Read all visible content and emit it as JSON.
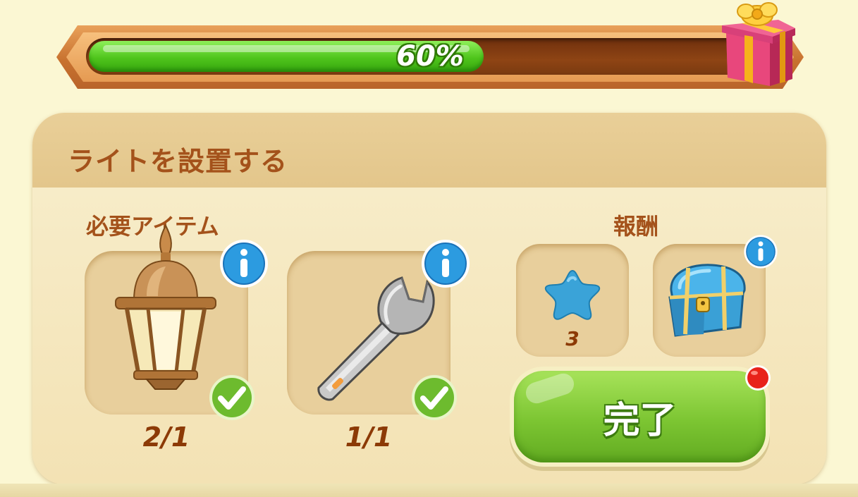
{
  "progress": {
    "value": 0.6,
    "label": "60%"
  },
  "quest": {
    "title": "ライトを設置する"
  },
  "required_items": {
    "label": "必要アイテム",
    "items": [
      {
        "icon": "lantern-icon",
        "count": "2/1",
        "complete": true
      },
      {
        "icon": "wrench-icon",
        "count": "1/1",
        "complete": true
      }
    ]
  },
  "rewards": {
    "label": "報酬",
    "items": [
      {
        "icon": "blue-star-icon",
        "count": "3"
      },
      {
        "icon": "treasure-chest-icon"
      }
    ]
  },
  "complete_button": {
    "label": "完了"
  },
  "colors": {
    "title_brown": "#a4521b",
    "progress_green": "#4fc51c",
    "button_green": "#7cc532",
    "panel_bg": "#f3e2b6",
    "page_bg": "#fbf7d3"
  }
}
